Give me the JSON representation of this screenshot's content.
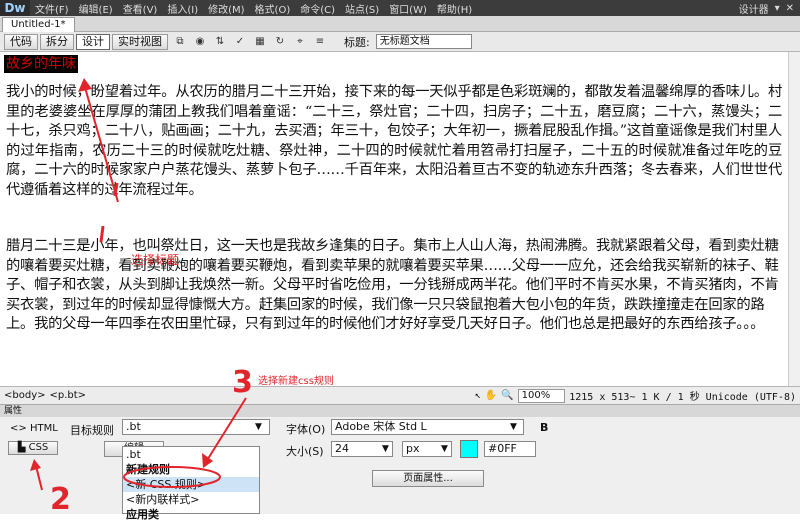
{
  "app": {
    "logo": "Dw"
  },
  "menubar": {
    "items": [
      "文件(F)",
      "编辑(E)",
      "查看(V)",
      "插入(I)",
      "修改(M)",
      "格式(O)",
      "命令(C)",
      "站点(S)",
      "窗口(W)",
      "帮助(H)"
    ],
    "workspace": "设计器"
  },
  "document": {
    "tab_name": "Untitled-1*"
  },
  "toolbar": {
    "view_buttons": [
      "代码",
      "拆分",
      "设计",
      "实时视图"
    ],
    "active_view": "设计",
    "title_label": "标题:",
    "title_value": "无标题文档"
  },
  "editor": {
    "heading": "故乡的年味",
    "paragraph1": "我小的时候，盼望着过年。从农历的腊月二十三开始，接下来的每一天似乎都是色彩斑斓的，都散发着温馨绵厚的香味儿。村里的老婆婆坐在厚厚的蒲团上教我们唱着童谣：“二十三，祭灶官；二十四，扫房子；二十五，磨豆腐；二十六，蒸馒头；二十七，杀只鸡；二十八，贴画画；二十九，去买酒；年三十，包饺子；大年初一，撅着屁股乱作揖。”这首童谣像是我们村里人的过年指南，农历二十三的时候就吃灶糖、祭灶神，二十四的时候就忙着用笤帚打扫屋子，二十五的时候就准备过年吃的豆腐，二十六的时候家家户户蒸花馒头、蒸萝卜包子……千百年来，太阳沿着亘古不变的轨迹东升西落；冬去春来，人们世世代代遵循着这样的过年流程过年。",
    "paragraph2": "腊月二十三是小年，也叫祭灶日，这一天也是我故乡逢集的日子。集市上人山人海，热闹沸腾。我就紧跟着父母，看到卖灶糖的嚷着要买灶糖，看到卖鞭炮的嚷着要买鞭炮，看到卖苹果的就嚷着要买苹果……父母一一应允，还会给我买崭新的袜子、鞋子、帽子和衣裳，从头到脚让我焕然一新。父母平时省吃俭用，一分钱掰成两半花。他们平时不肯买水果，不肯买猪肉，不肯买衣裳，到过年的时候却显得慷慨大方。赶集回家的时候，我们像一只只袋鼠抱着大包小包的年货，跌跌撞撞走在回家的路上。我的父母一年四季在农田里忙碌，只有到过年的时候他们才好好享受几天好日子。他们也总是把最好的东西给孩子。。。"
  },
  "annotations": {
    "note1": "选择标题",
    "step3": "3",
    "step3_text": "选择新建css规则",
    "step2": "2"
  },
  "statusbar": {
    "tags": [
      "<body>",
      "<p.bt>"
    ],
    "zoom": "100%",
    "info": "1215 x 513~ 1 K / 1 秒 Unicode (UTF-8)"
  },
  "properties": {
    "panel_title": "属性",
    "html_button": "HTML",
    "css_button": "CSS",
    "target_rule_label": "目标规则",
    "target_rule_value": ".bt",
    "edit_rule_button": "编辑",
    "font_label": "字体(O)",
    "font_value": "Adobe 宋体 Std L",
    "size_label": "大小(S)",
    "size_value": "24",
    "size_unit": "px",
    "color_value": "#0FF",
    "page_props_button": "页面属性...",
    "bold_button": "B",
    "dropdown_options": [
      ".bt",
      "新建规则",
      "<新 CSS 规则>",
      "<新内联样式>",
      "应用类"
    ]
  },
  "colors": {
    "annotation": "#e1252a",
    "swatch": "#00ffff",
    "heading_text": "#cc0000"
  }
}
